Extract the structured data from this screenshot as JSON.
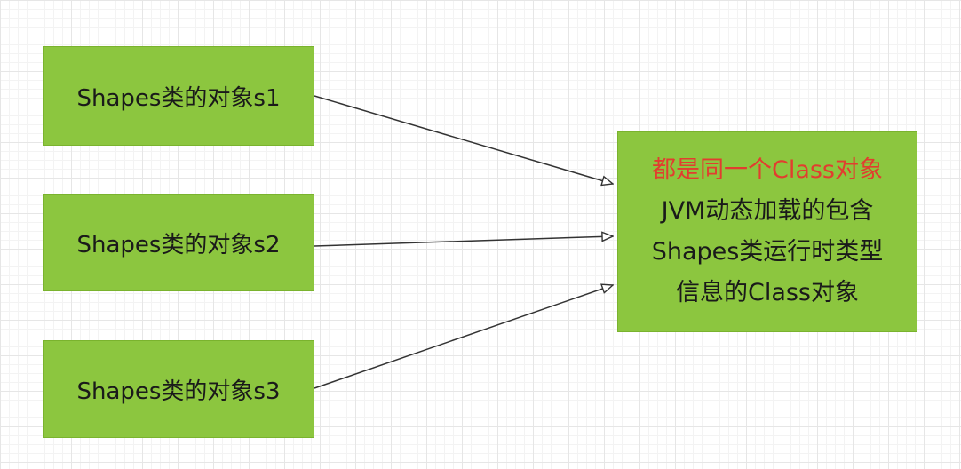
{
  "sources": [
    {
      "label": "Shapes类的对象s1"
    },
    {
      "label": "Shapes类的对象s2"
    },
    {
      "label": "Shapes类的对象s3"
    }
  ],
  "target": {
    "line1": "都是同一个Class对象",
    "line2": "JVM动态加载的包含",
    "line3": "Shapes类运行时类型",
    "line4": "信息的Class对象"
  },
  "colors": {
    "box_fill": "#8cc63f",
    "highlight_text": "#e23d2f",
    "arrow": "#333333"
  }
}
